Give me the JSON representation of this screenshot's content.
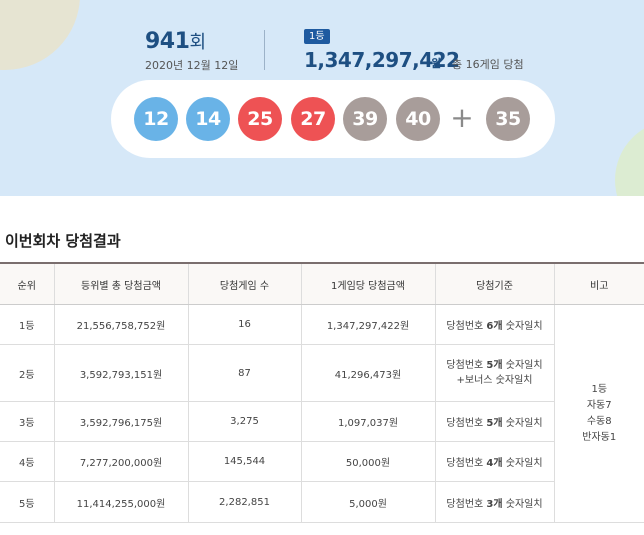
{
  "header": {
    "round_number": "941",
    "round_suffix": "회",
    "draw_date": "2020년 12월 12일",
    "rank_badge": "1등",
    "first_prize": "1,347,297,422",
    "first_prize_unit": "원",
    "winners_text": "총 16게임 당첨"
  },
  "balls": [
    {
      "number": "12",
      "color": "#69b3e7"
    },
    {
      "number": "14",
      "color": "#69b3e7"
    },
    {
      "number": "25",
      "color": "#ee5254"
    },
    {
      "number": "27",
      "color": "#ee5254"
    },
    {
      "number": "39",
      "color": "#a89d9a"
    },
    {
      "number": "40",
      "color": "#a89d9a"
    }
  ],
  "plus_sign": "+",
  "bonus_ball": {
    "number": "35",
    "color": "#a89d9a"
  },
  "section_title": "이번회차 당첨결과",
  "table": {
    "headers": [
      "순위",
      "등위별 총 당첨금액",
      "당첨게임 수",
      "1게임당 당첨금액",
      "당첨기준",
      "비고"
    ],
    "rows": [
      {
        "rank": "1등",
        "total": "21,556,758,752원",
        "games": "16",
        "per_game": "1,347,297,422원",
        "criteria": [
          "당첨번호 ",
          "6개",
          " 숫자일치"
        ],
        "criteria2": ""
      },
      {
        "rank": "2등",
        "total": "3,592,793,151원",
        "games": "87",
        "per_game": "41,296,473원",
        "criteria": [
          "당첨번호 ",
          "5개",
          " 숫자일치"
        ],
        "criteria2": "+보너스 숫자일치"
      },
      {
        "rank": "3등",
        "total": "3,592,796,175원",
        "games": "3,275",
        "per_game": "1,097,037원",
        "criteria": [
          "당첨번호 ",
          "5개",
          " 숫자일치"
        ],
        "criteria2": ""
      },
      {
        "rank": "4등",
        "total": "7,277,200,000원",
        "games": "145,544",
        "per_game": "50,000원",
        "criteria": [
          "당첨번호 ",
          "4개",
          " 숫자일치"
        ],
        "criteria2": ""
      },
      {
        "rank": "5등",
        "total": "11,414,255,000원",
        "games": "2,282,851",
        "per_game": "5,000원",
        "criteria": [
          "당첨번호 ",
          "3개",
          " 숫자일치"
        ],
        "criteria2": ""
      }
    ],
    "note": [
      "1등",
      "자동7",
      "수동8",
      "반자동1"
    ]
  }
}
